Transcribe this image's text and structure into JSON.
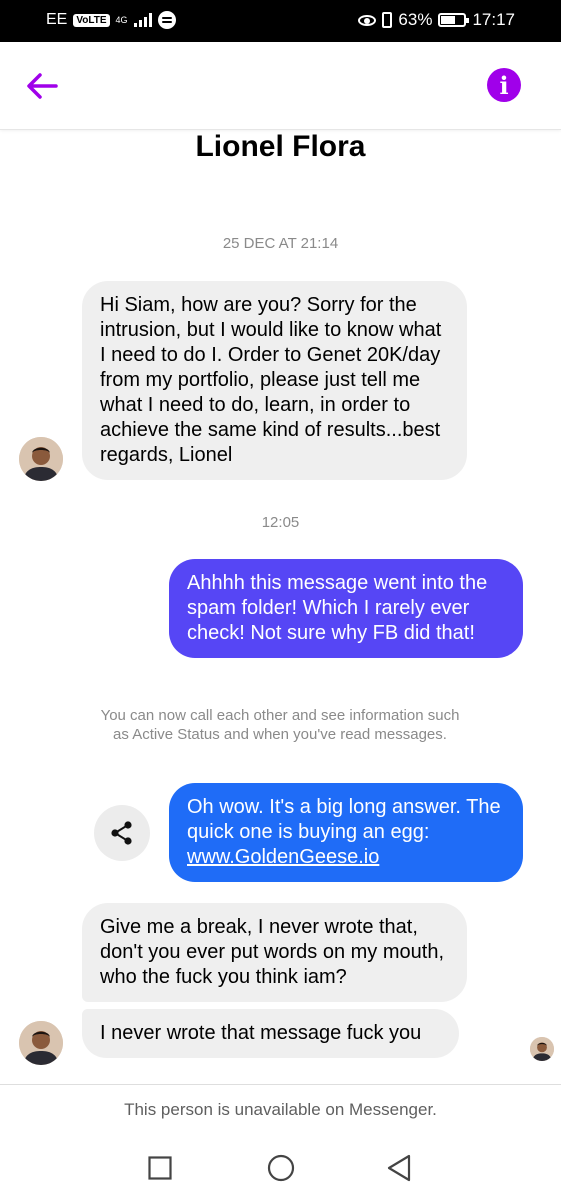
{
  "status_bar": {
    "carrier": "EE",
    "volte": "VoLTE",
    "network": "4G",
    "battery_percent": "63%",
    "time": "17:17",
    "battery_level": 0.63
  },
  "header": {
    "back_icon": "arrow-left-icon",
    "info_icon": "info-icon",
    "info_glyph": "i",
    "accent_color": "#a000ea"
  },
  "contact_name": "Lionel Flora",
  "messages": {
    "ts1": "25 DEC AT 21:14",
    "msg1": "Hi Siam, how are you? Sorry for the intrusion, but I would like to know what I need to do I. Order to Genet 20K/day from my portfolio, please just tell me what I need to do, learn, in order to achieve the same kind of results...best regards, Lionel",
    "ts2": "12:05",
    "msg2": "Ahhhh this message went into the spam folder! Which I rarely ever check! Not sure why FB did that!",
    "notice": "You can now call each other and see information such as Active Status and when you've read messages.",
    "msg3_text": "Oh wow. It's a big long answer. The quick one is buying an egg: ",
    "msg3_link": "www.GoldenGeese.io",
    "msg4": "Give me a break, I never wrote that, don't you ever put words on my mouth, who the fuck you think iam?",
    "msg5": "I never wrote that message fuck you"
  },
  "colors": {
    "outgoing_purple": "#5646f5",
    "outgoing_blue": "#1f6cf7",
    "incoming_bg": "#efefef"
  },
  "footer": {
    "unavailable_text": "This person is unavailable on Messenger."
  },
  "nav": {
    "icons": [
      "square-icon",
      "circle-icon",
      "triangle-back-icon"
    ]
  }
}
